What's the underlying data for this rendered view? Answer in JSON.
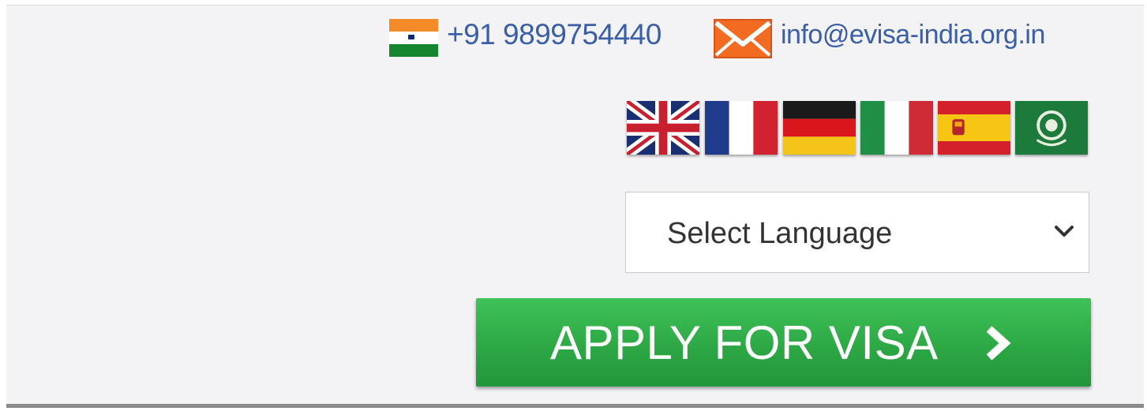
{
  "contact": {
    "phone": "+91 9899754440",
    "email": "info@evisa-india.org.in",
    "phone_icon": "india-flag-icon",
    "email_icon": "envelope-icon"
  },
  "languages": [
    {
      "name": "English",
      "icon": "uk-flag-icon"
    },
    {
      "name": "French",
      "icon": "france-flag-icon"
    },
    {
      "name": "German",
      "icon": "germany-flag-icon"
    },
    {
      "name": "Italian",
      "icon": "italy-flag-icon"
    },
    {
      "name": "Spanish",
      "icon": "spain-flag-icon"
    },
    {
      "name": "Arabic",
      "icon": "arab-league-flag-icon"
    }
  ],
  "language_select": {
    "selected": "Select Language",
    "icon": "chevron-down-icon"
  },
  "apply_button": {
    "label": "APPLY FOR VISA",
    "icon": "chevron-right-icon"
  },
  "colors": {
    "link_text": "#3a5ea8",
    "button_green": "#2da845",
    "panel_bg": "#f3f2f4",
    "mail_orange": "#f26b21"
  }
}
